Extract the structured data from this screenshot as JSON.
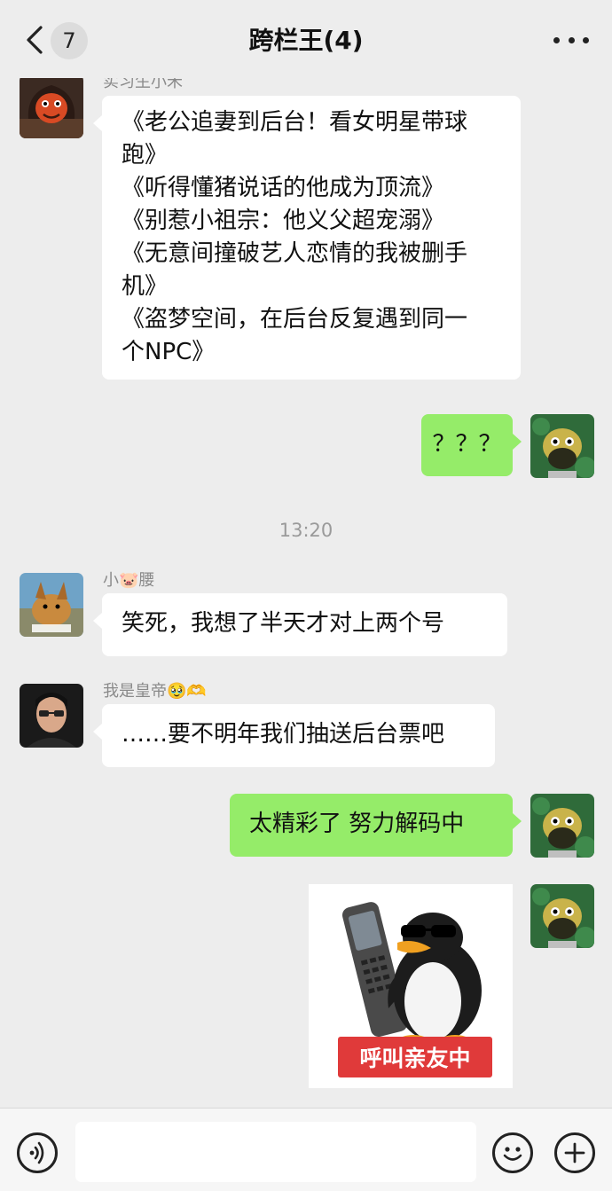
{
  "header": {
    "back_icon": "chevron-left-icon",
    "unread_count": "7",
    "title": "跨栏王(4)",
    "more_icon": "more-dots-icon"
  },
  "messages": [
    {
      "side": "left",
      "sender": "实习生小禾",
      "lines": [
        "《老公追妻到后台！看女明星带球",
        "跑》",
        "《听得懂猪说话的他成为顶流》",
        "《别惹小祖宗：他义父超宠溺》",
        "《无意间撞破艺人恋情的我被删手",
        "机》",
        "《盗梦空间，在后台反复遇到同一",
        "个NPC》"
      ]
    },
    {
      "side": "right",
      "lines": [
        "？？？"
      ]
    },
    {
      "side": "left",
      "sender_prefix": "小",
      "sender_emoji": "🐷",
      "sender_suffix": "腰",
      "lines": [
        "笑死，我想了半天才对上两个号"
      ]
    },
    {
      "side": "left",
      "sender_prefix": "我是皇帝",
      "sender_emoji": "🥹🫶",
      "lines": [
        "……要不明年我们抽送后台票吧"
      ]
    },
    {
      "side": "right",
      "lines": [
        "太精彩了 努力解码中"
      ]
    },
    {
      "side": "right",
      "sticker_text": "呼叫亲友中"
    }
  ],
  "timestamp": "13:20",
  "input": {
    "placeholder": ""
  },
  "bottom_icons": [
    "voice-icon",
    "emoji-icon",
    "plus-icon"
  ],
  "colors": {
    "background": "#ededed",
    "sent_bubble": "#95ec69",
    "received_bubble": "#ffffff",
    "sticker_label": "#e03a3a"
  }
}
